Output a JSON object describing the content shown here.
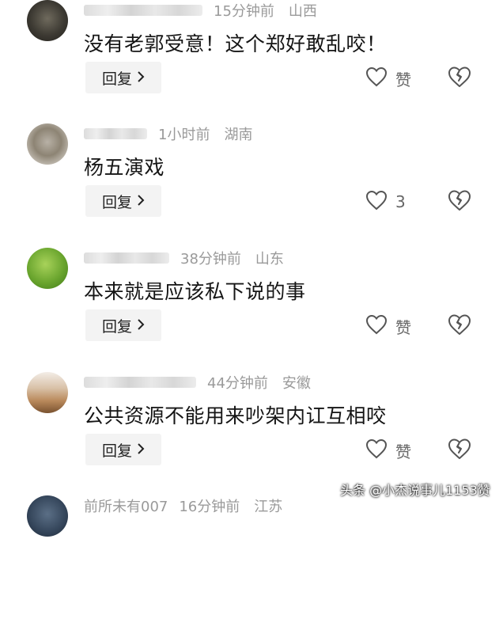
{
  "comments": [
    {
      "time": "15分钟前",
      "location": "山西",
      "text": "没有老郭受意！这个郑好敢乱咬！",
      "reply_label": "回复",
      "like_label": "赞"
    },
    {
      "time": "1小时前",
      "location": "湖南",
      "text": "杨五演戏",
      "reply_label": "回复",
      "like_label": "3"
    },
    {
      "time": "38分钟前",
      "location": "山东",
      "text": "本来就是应该私下说的事",
      "reply_label": "回复",
      "like_label": "赞"
    },
    {
      "time": "44分钟前",
      "location": "安徽",
      "text": "公共资源不能用来吵架内讧互相咬",
      "reply_label": "回复",
      "like_label": "赞"
    },
    {
      "username": "前所未有007",
      "time": "16分钟前",
      "location": "江苏"
    }
  ],
  "icons": {
    "reply_chevron": "chevron-right-icon",
    "like": "heart-icon",
    "dislike": "broken-heart-icon"
  },
  "watermark": "头条 @小杰说事儿1153赞"
}
